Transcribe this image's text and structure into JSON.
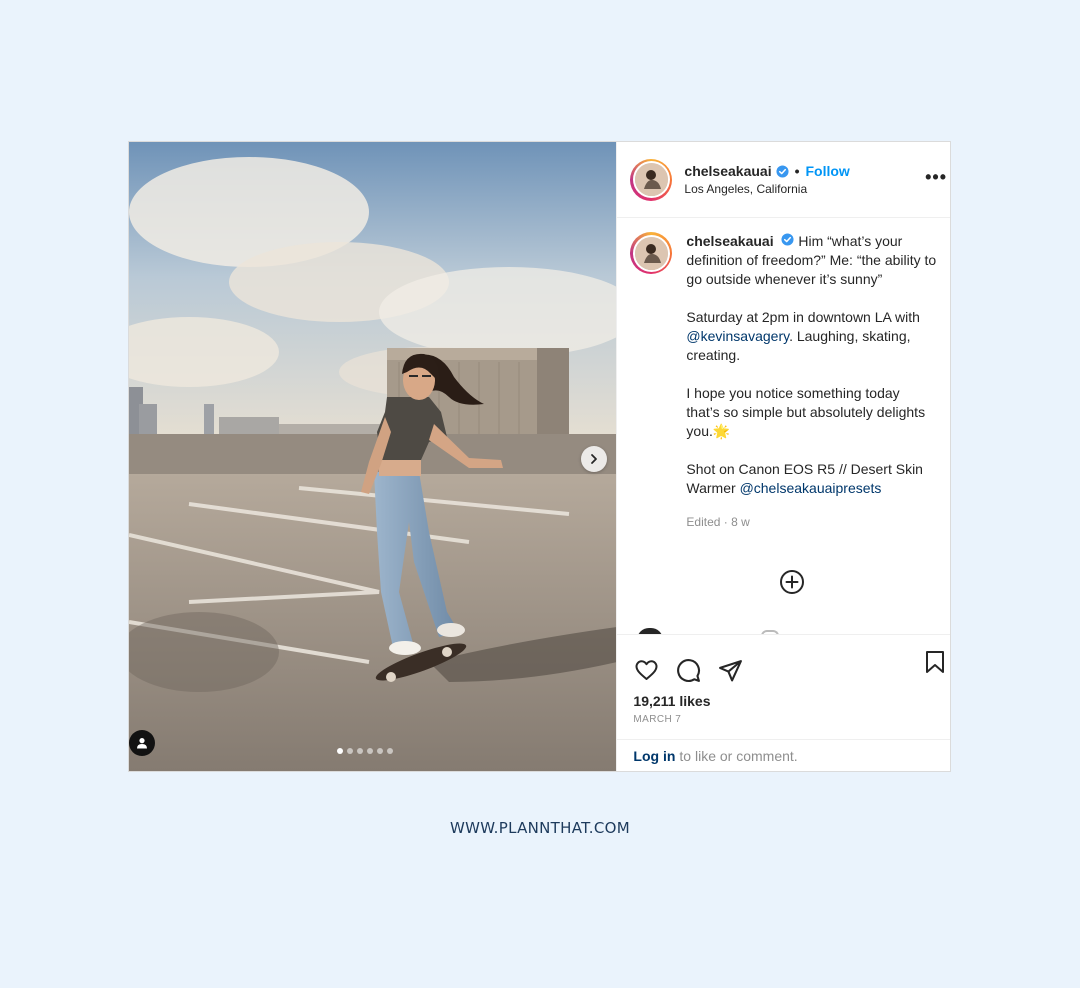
{
  "post": {
    "username": "chelseakauai",
    "verified": true,
    "separator": "•",
    "follow_label": "Follow",
    "location": "Los Angeles, California",
    "more_label": "•••",
    "media": {
      "slides_total": 6,
      "active_slide": 1,
      "next_icon": "chevron-right-icon",
      "user_tag_icon": "person-icon"
    },
    "caption": {
      "username": "chelseakauai",
      "para1": "Him “what’s your definition of freedom?” Me: “the ability to go outside whenever it’s sunny”",
      "para2_before": "Saturday at 2pm in downtown LA with ",
      "para2_mention": "@kevinsavagery",
      "para2_after": ". Laughing, skating, creating.",
      "para3": "I hope you notice something today that’s so simple but absolutely delights you.🌟",
      "para4_before": "Shot on Canon EOS R5 // Desert Skin Warmer ",
      "para4_mention": "@chelseakauaipresets",
      "meta": "Edited · 8 w"
    },
    "actions": {
      "like_icon": "heart-icon",
      "comment_icon": "comment-icon",
      "share_icon": "paper-plane-icon",
      "save_icon": "bookmark-icon",
      "load_more_icon": "plus-circle-icon"
    },
    "likes": "19,211 likes",
    "date": "MARCH 7",
    "login_link": "Log in",
    "login_text": "to like or comment."
  },
  "footer": {
    "url": "WWW.PLANNTHAT.COM"
  },
  "colors": {
    "background": "#eaf3fc",
    "link_blue": "#0095f6",
    "mention": "#00376b",
    "footer_text": "#1d3a5c"
  }
}
